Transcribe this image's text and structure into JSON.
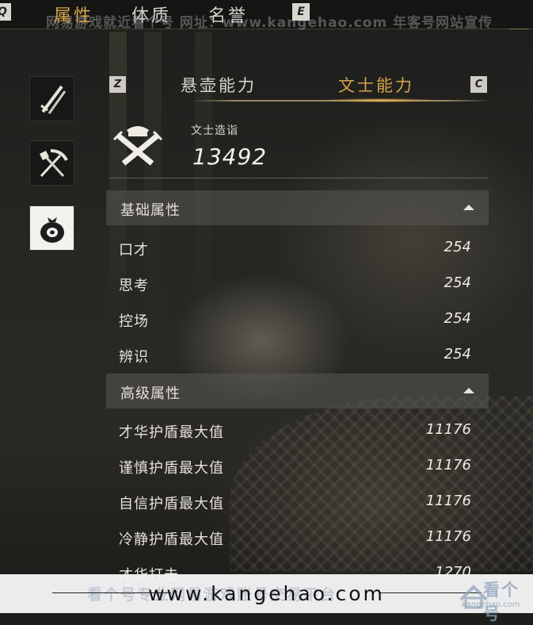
{
  "top_tabs": [
    {
      "label": "属性",
      "active": true
    },
    {
      "label": "体质",
      "active": false
    },
    {
      "label": "名誉",
      "active": false
    }
  ],
  "keys": {
    "prev_tab": "Q",
    "next_tab": "E",
    "prev_sub": "Z",
    "next_sub": "C"
  },
  "watermark_top": "网易游戏就近看个号  网址：www.kangehao.com 年客号网站宣传",
  "side_icons": [
    "sword-icon",
    "pickaxe-icon",
    "money-bag-icon"
  ],
  "sub_tabs": [
    {
      "label": "悬壶能力",
      "active": false
    },
    {
      "label": "文士能力",
      "active": true
    }
  ],
  "stat": {
    "label": "文士造诣",
    "value": "13492"
  },
  "sections": [
    {
      "title": "基础属性",
      "rows": [
        {
          "name": "口才",
          "value": "254"
        },
        {
          "name": "思考",
          "value": "254"
        },
        {
          "name": "控场",
          "value": "254"
        },
        {
          "name": "辨识",
          "value": "254"
        }
      ]
    },
    {
      "title": "高级属性",
      "rows": [
        {
          "name": "才华护盾最大值",
          "value": "11176"
        },
        {
          "name": "谨慎护盾最大值",
          "value": "11176"
        },
        {
          "name": "自信护盾最大值",
          "value": "11176"
        },
        {
          "name": "冷静护盾最大值",
          "value": "11176"
        },
        {
          "name": "才华打击",
          "value": "1270"
        }
      ]
    }
  ],
  "bottom_watermark": {
    "url": "www.kangehao.com",
    "faint": "看个号专业网易游戏账号交易平台",
    "logo_text": "看个号",
    "logo_sub": "kangehao.com"
  },
  "colors": {
    "accent": "#d6a44a",
    "panel": "#5a5854"
  }
}
